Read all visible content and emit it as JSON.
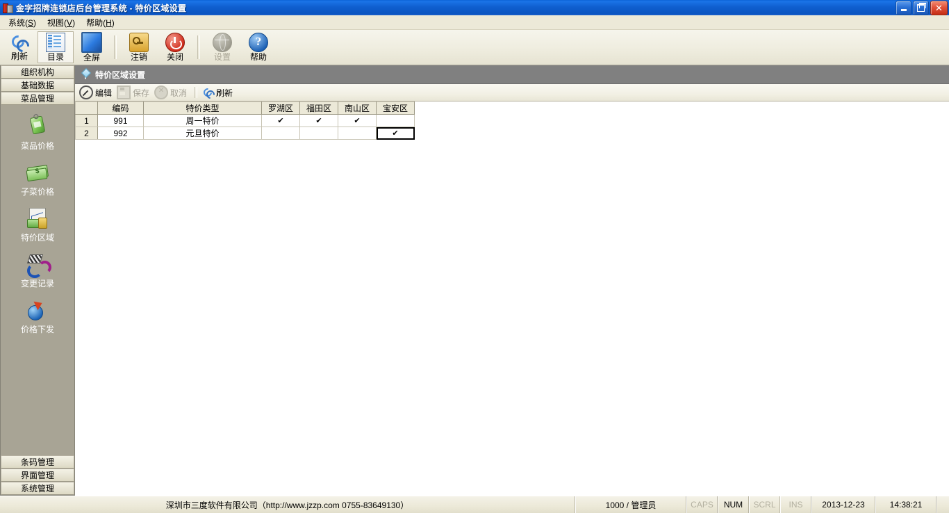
{
  "window": {
    "title": "金字招牌连锁店后台管理系统  -  特价区域设置",
    "minimize_label": "",
    "maximize_label": "",
    "close_label": "✕"
  },
  "menubar": {
    "items": [
      {
        "label": "系统",
        "accel": "S"
      },
      {
        "label": "视图",
        "accel": "V"
      },
      {
        "label": "帮助",
        "accel": "H"
      }
    ]
  },
  "toolbar": {
    "buttons": [
      {
        "label": "刷新",
        "icon": "refresh-icon",
        "state": "normal"
      },
      {
        "label": "目录",
        "icon": "catalog-icon",
        "state": "pressed"
      },
      {
        "label": "全屏",
        "icon": "fullscreen-icon",
        "state": "normal"
      },
      {
        "label": "注销",
        "icon": "key-logout-icon",
        "state": "normal"
      },
      {
        "label": "关闭",
        "icon": "power-close-icon",
        "state": "normal"
      },
      {
        "label": "设置",
        "icon": "globe-settings-icon",
        "state": "disabled"
      },
      {
        "label": "帮助",
        "icon": "help-question-icon",
        "state": "normal"
      }
    ]
  },
  "sidebar": {
    "top_sections": [
      "组织机构",
      "基础数据",
      "菜品管理"
    ],
    "active_section": "菜品管理",
    "items": [
      {
        "label": "菜品价格",
        "icon": "price-tag-icon"
      },
      {
        "label": "子菜价格",
        "icon": "money-icon"
      },
      {
        "label": "特价区域",
        "icon": "chart-money-icon"
      },
      {
        "label": "变更记录",
        "icon": "change-arrows-icon"
      },
      {
        "label": "价格下发",
        "icon": "price-publish-icon"
      }
    ],
    "bottom_sections": [
      "条码管理",
      "界面管理",
      "系统管理"
    ]
  },
  "panel": {
    "title": "特价区域设置",
    "title_icon": "diamond-pin-icon",
    "actions": [
      {
        "label": "编辑",
        "icon": "edit-icon",
        "enabled": true
      },
      {
        "label": "保存",
        "icon": "save-icon",
        "enabled": false
      },
      {
        "label": "取消",
        "icon": "cancel-icon",
        "enabled": false
      },
      {
        "label": "刷新",
        "icon": "refresh-icon",
        "enabled": true
      }
    ]
  },
  "grid": {
    "columns": [
      "",
      "编码",
      "特价类型",
      "罗湖区",
      "福田区",
      "南山区",
      "宝安区"
    ],
    "check_glyph": "✔",
    "rows": [
      {
        "num": "1",
        "code": "991",
        "type": "周一特价",
        "checks": [
          "✔",
          "✔",
          "✔",
          ""
        ],
        "focused_col": -1
      },
      {
        "num": "2",
        "code": "992",
        "type": "元旦特价",
        "checks": [
          "",
          "",
          "",
          "✔"
        ],
        "focused_col": 3
      }
    ]
  },
  "statusbar": {
    "company": "深圳市三度软件有限公司（http://www.jzzp.com  0755-83649130）",
    "user": "1000 / 管理员",
    "keys": [
      {
        "label": "CAPS",
        "active": false
      },
      {
        "label": "NUM",
        "active": true
      },
      {
        "label": "SCRL",
        "active": false
      },
      {
        "label": "INS",
        "active": false
      }
    ],
    "date": "2013-12-23",
    "time": "14:38:21"
  },
  "colors": {
    "title_bar": "#0a54c0",
    "panel_header": "#808080",
    "sidebar_bg": "#a8a495",
    "chrome_bg": "#ece9d8",
    "close_button": "#c32d15"
  }
}
